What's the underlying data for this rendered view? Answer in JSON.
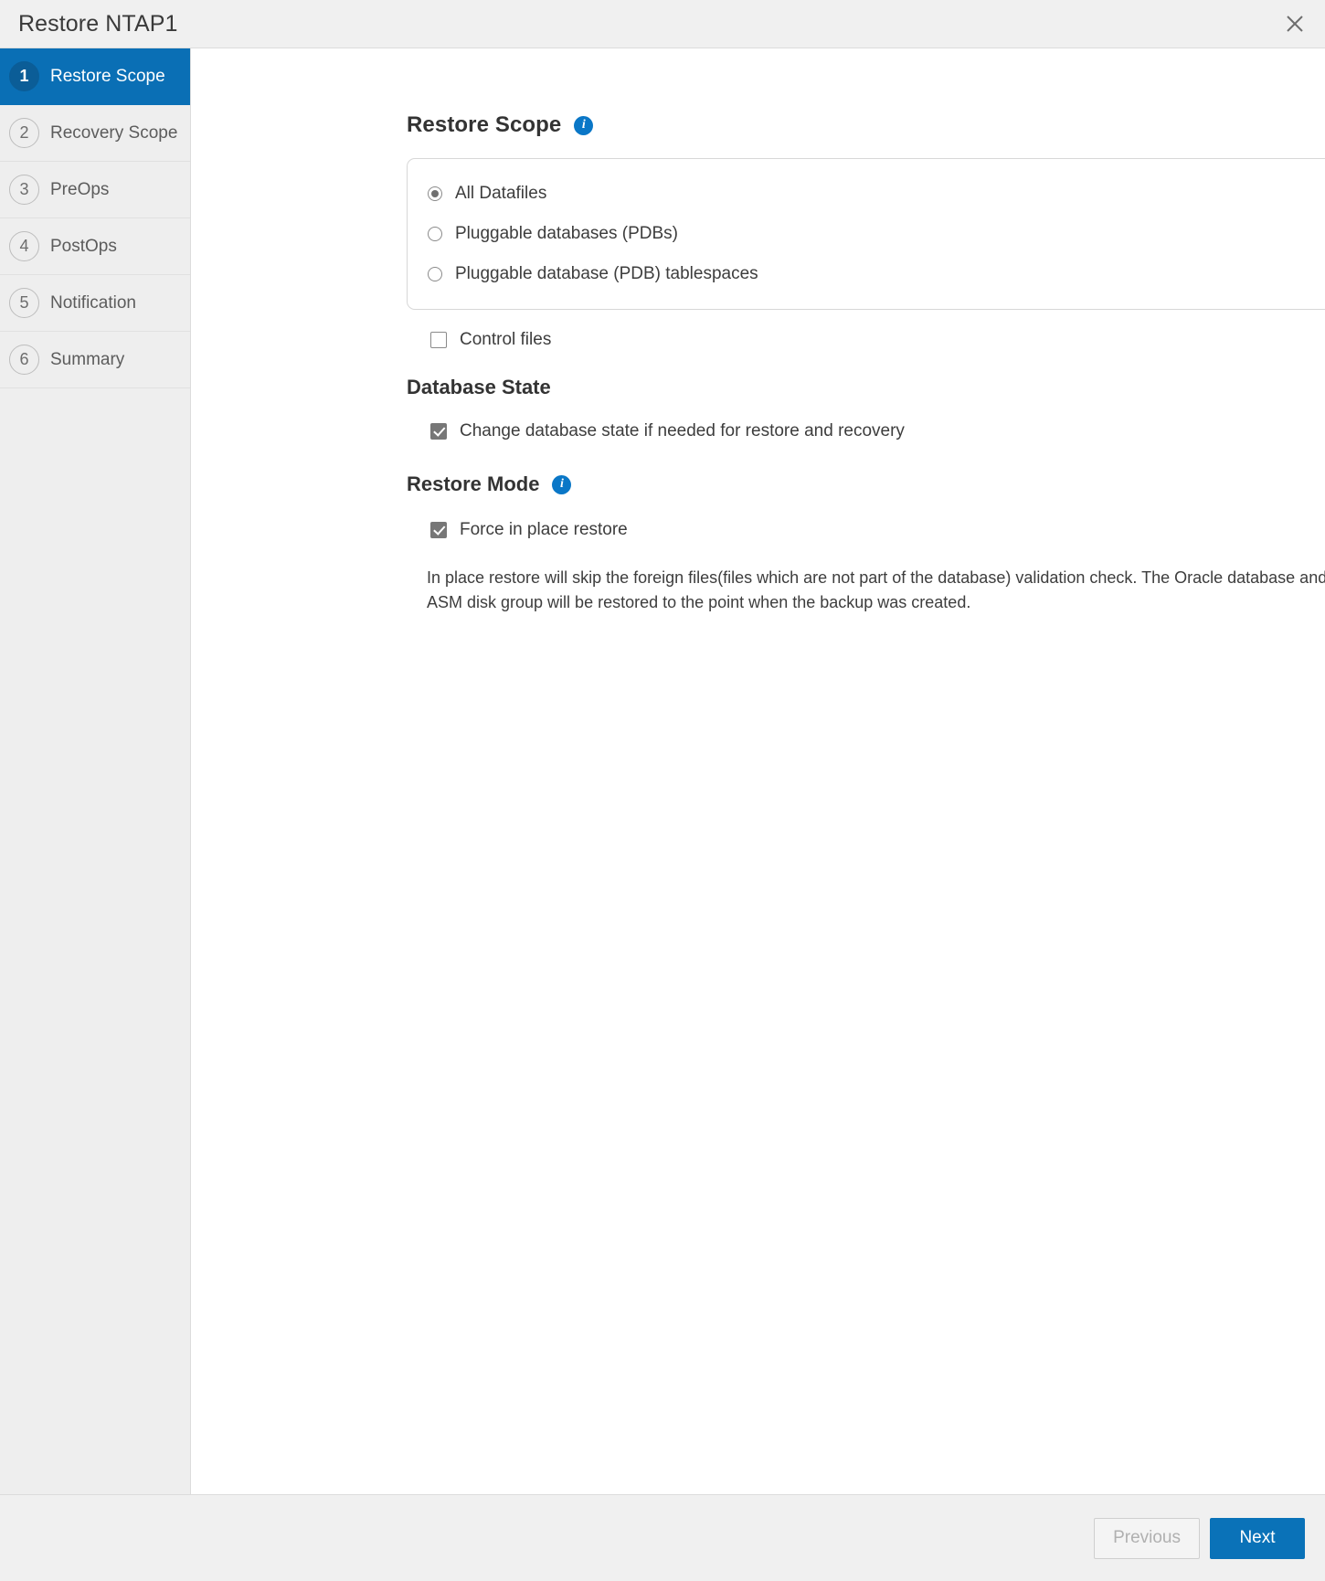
{
  "window": {
    "title": "Restore NTAP1",
    "close_icon": "close-icon"
  },
  "sidebar": {
    "items": [
      {
        "number": "1",
        "label": "Restore Scope",
        "active": true
      },
      {
        "number": "2",
        "label": "Recovery Scope",
        "active": false
      },
      {
        "number": "3",
        "label": "PreOps",
        "active": false
      },
      {
        "number": "4",
        "label": "PostOps",
        "active": false
      },
      {
        "number": "5",
        "label": "Notification",
        "active": false
      },
      {
        "number": "6",
        "label": "Summary",
        "active": false
      }
    ]
  },
  "main": {
    "restore_scope": {
      "heading": "Restore Scope",
      "info_icon": "info-icon",
      "options": [
        {
          "label": "All Datafiles",
          "checked": true
        },
        {
          "label": "Pluggable databases (PDBs)",
          "checked": false
        },
        {
          "label": "Pluggable database (PDB) tablespaces",
          "checked": false
        }
      ],
      "control_files": {
        "label": "Control files",
        "checked": false
      }
    },
    "database_state": {
      "heading": "Database State",
      "change_state": {
        "label": "Change database state if needed for restore and recovery",
        "checked": true
      }
    },
    "restore_mode": {
      "heading": "Restore Mode",
      "info_icon": "info-icon",
      "force_in_place": {
        "label": "Force in place restore",
        "checked": true
      },
      "description": "In place restore will skip the foreign files(files which are not part of the database) validation check. The Oracle database and the ASM disk group will be restored to the point when the backup was created."
    }
  },
  "footer": {
    "previous_label": "Previous",
    "next_label": "Next"
  },
  "colors": {
    "accent": "#0a72b8",
    "active_step": "#0a6fb5",
    "info": "#0a77c7",
    "sidebar_bg": "#eeeeee",
    "titlebar_bg": "#f0f0f0"
  }
}
